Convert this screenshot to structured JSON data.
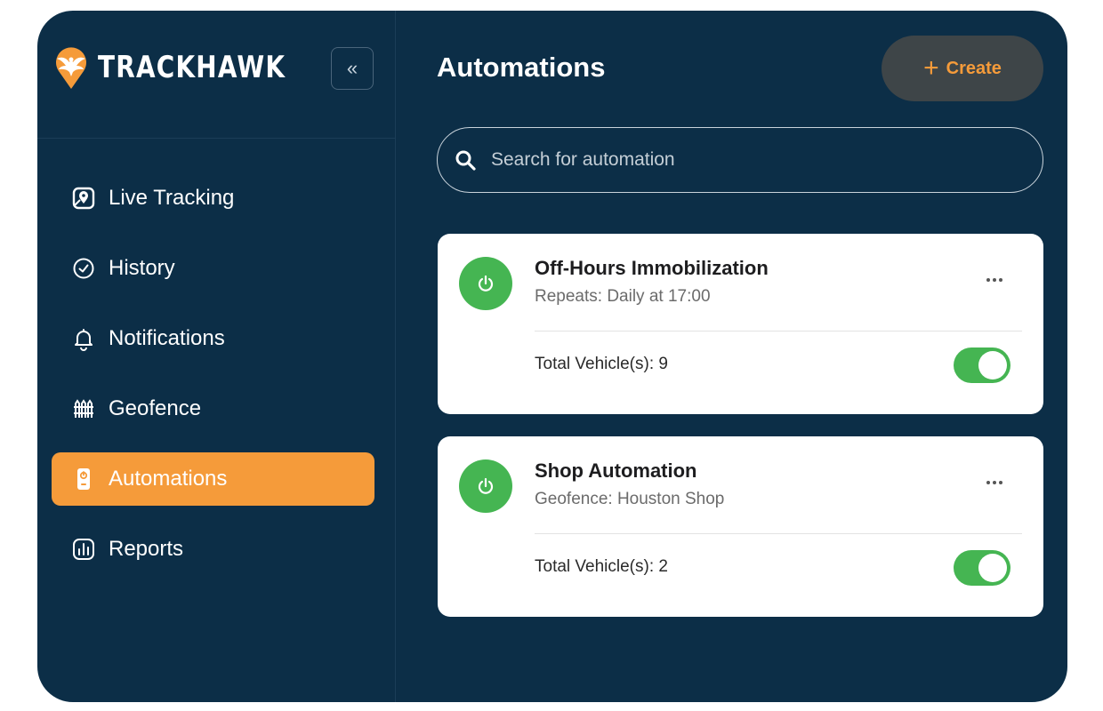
{
  "brand": {
    "name": "TRACKHAWK"
  },
  "sidebar": {
    "collapse_label": "«",
    "items": [
      {
        "label": "Live Tracking",
        "icon": "map-pin-icon",
        "active": false
      },
      {
        "label": "History",
        "icon": "clock-icon",
        "active": false
      },
      {
        "label": "Notifications",
        "icon": "bell-icon",
        "active": false
      },
      {
        "label": "Geofence",
        "icon": "fence-icon",
        "active": false
      },
      {
        "label": "Automations",
        "icon": "remote-icon",
        "active": true
      },
      {
        "label": "Reports",
        "icon": "bar-chart-icon",
        "active": false
      }
    ]
  },
  "header": {
    "title": "Automations",
    "create_plus": "+",
    "create_label": "Create"
  },
  "search": {
    "placeholder": "Search for automation",
    "value": ""
  },
  "automations": [
    {
      "title": "Off-Hours Immobilization",
      "subtitle": "Repeats: Daily at 17:00",
      "vehicles": "Total Vehicle(s): 9",
      "enabled": true
    },
    {
      "title": "Shop Automation",
      "subtitle": "Geofence: Houston Shop",
      "vehicles": "Total Vehicle(s): 2",
      "enabled": true
    }
  ],
  "colors": {
    "background": "#0c2e47",
    "accent": "#f59b3a",
    "success": "#45b552"
  }
}
